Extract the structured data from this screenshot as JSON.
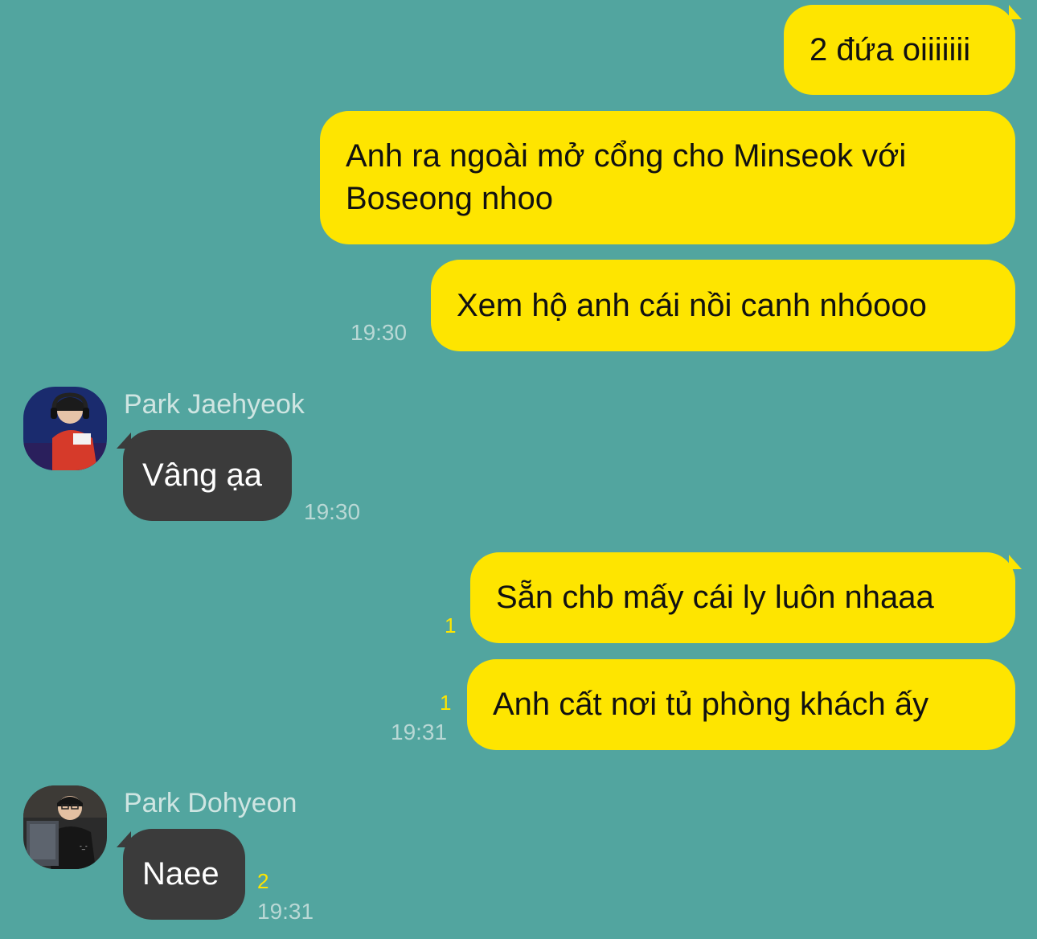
{
  "theme": {
    "background": "#52a59f",
    "outgoing_bubble": "#fee500",
    "incoming_bubble": "#3b3b3b",
    "timestamp_color": "#b9d8d5",
    "unread_color": "#fee500"
  },
  "messages": [
    {
      "direction": "out",
      "text": "2 đứa oiiiiiii"
    },
    {
      "direction": "out",
      "text": "Anh ra ngoài mở cổng cho Minseok với Boseong nhoo"
    },
    {
      "direction": "out",
      "text": "Xem hộ anh cái nồi canh nhóooo",
      "time": "19:30"
    },
    {
      "direction": "in",
      "sender": "Park Jaehyeok",
      "avatar_icon": "avatar-photo-headset",
      "text": "Vâng ạa",
      "time": "19:30"
    },
    {
      "direction": "out",
      "text": "Sẵn chb mấy cái ly luôn nhaaa",
      "unread": "1"
    },
    {
      "direction": "out",
      "text": "Anh cất nơi tủ phòng khách ấy",
      "unread": "1",
      "time": "19:31"
    },
    {
      "direction": "in",
      "sender": "Park Dohyeon",
      "avatar_icon": "avatar-photo-monitor",
      "text": "Naee",
      "unread": "2",
      "time": "19:31"
    }
  ]
}
